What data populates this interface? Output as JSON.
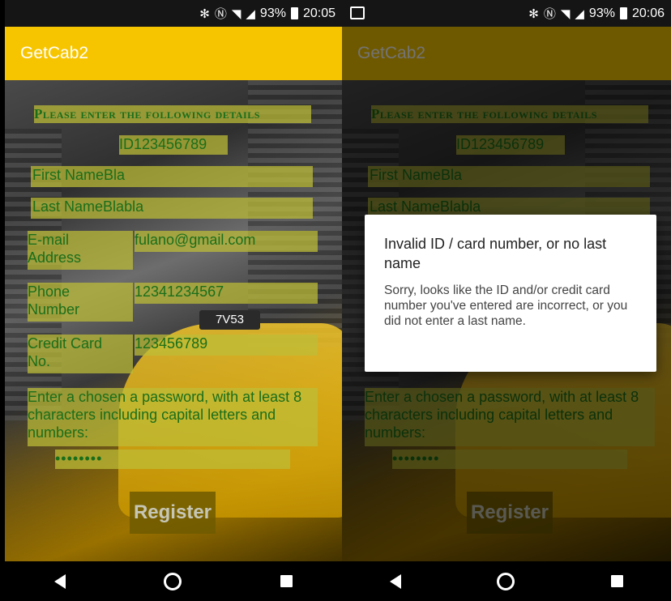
{
  "status_bar": {
    "battery": "93%",
    "time_left": "20:05",
    "time_right": "20:06",
    "icons": [
      "bluetooth-icon",
      "nfc-icon",
      "wifi-icon",
      "signal-icon",
      "battery-icon"
    ]
  },
  "app": {
    "title": "GetCab2",
    "accent": "#f7c500"
  },
  "form": {
    "heading": "Please enter the following details",
    "id_value": "ID123456789",
    "first_name_label": "First Name",
    "first_name_value": "Bla",
    "last_name_label": "Last Name",
    "last_name_value": "Blabla",
    "email_label_1": "E-mail",
    "email_label_2": "Address",
    "email_value": "fulano@gmail.com",
    "phone_label_1": "Phone",
    "phone_label_2": "Number",
    "phone_value": "12341234567",
    "card_label_1": "Credit Card",
    "card_label_2": "No.",
    "card_value": "123456789",
    "password_hint": "Enter a chosen a password, with at least 8 characters including capital letters and numbers:",
    "password_value": "••••••••",
    "register_label": "Register"
  },
  "background": {
    "taxi_sign": "7V53"
  },
  "dialog": {
    "title": "Invalid ID / card number, or no last name",
    "message": "Sorry, looks like the ID and/or credit card number you've entered are incorrect, or you did not enter a last name."
  }
}
